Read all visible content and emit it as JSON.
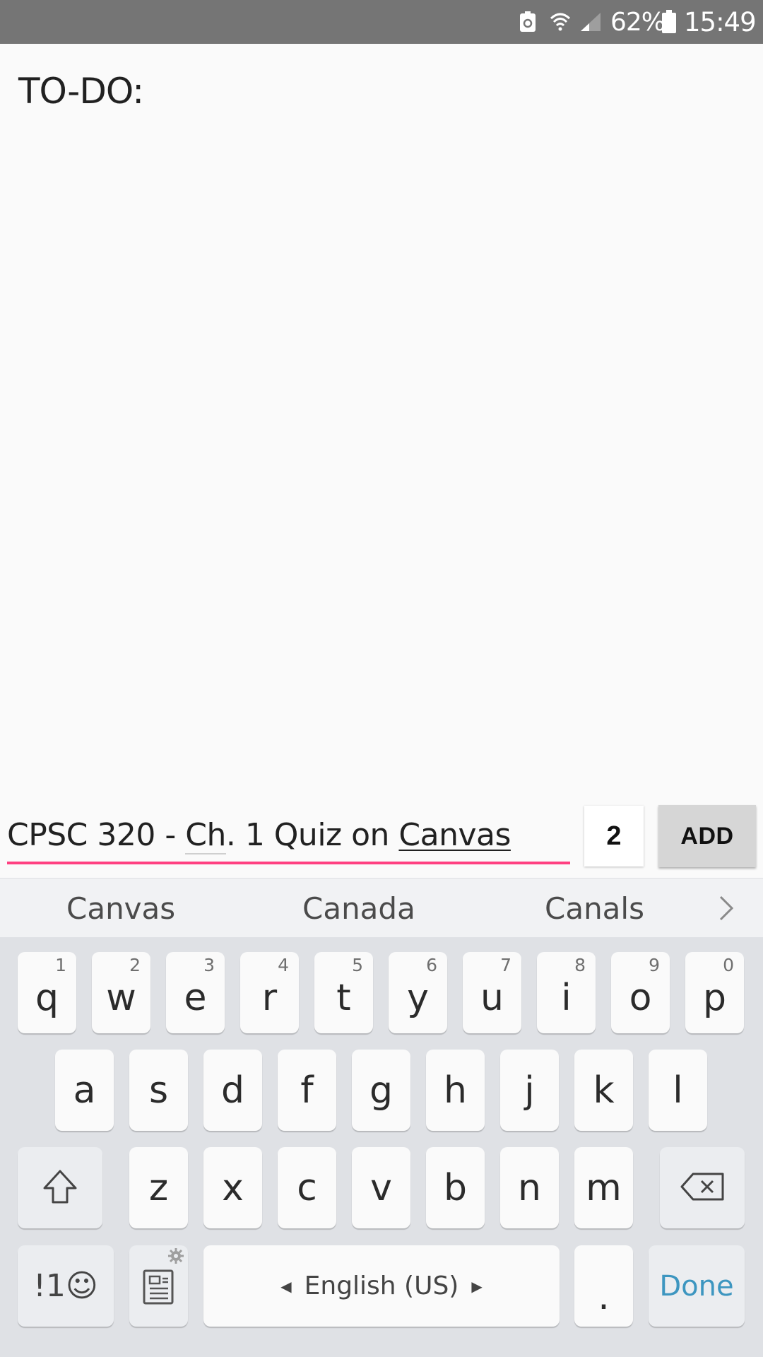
{
  "status_bar": {
    "battery_percent": "62%",
    "time": "15:49"
  },
  "page": {
    "title": "TO-DO:"
  },
  "input_row": {
    "task_segments": [
      "CPSC 320 - ",
      "Ch",
      ". 1 Quiz on ",
      "Canvas"
    ],
    "priority_value": "2",
    "add_label": "ADD"
  },
  "keyboard": {
    "suggestions": [
      "Canvas",
      "Canada",
      "Canals"
    ],
    "row1": [
      {
        "char": "q",
        "num": "1"
      },
      {
        "char": "w",
        "num": "2"
      },
      {
        "char": "e",
        "num": "3"
      },
      {
        "char": "r",
        "num": "4"
      },
      {
        "char": "t",
        "num": "5"
      },
      {
        "char": "y",
        "num": "6"
      },
      {
        "char": "u",
        "num": "7"
      },
      {
        "char": "i",
        "num": "8"
      },
      {
        "char": "o",
        "num": "9"
      },
      {
        "char": "p",
        "num": "0"
      }
    ],
    "row2": [
      "a",
      "s",
      "d",
      "f",
      "g",
      "h",
      "j",
      "k",
      "l"
    ],
    "row3": [
      "z",
      "x",
      "c",
      "v",
      "b",
      "n",
      "m"
    ],
    "symbols_label": "!1☺",
    "space_label": "English (US)",
    "period_label": ".",
    "done_label": "Done"
  }
}
